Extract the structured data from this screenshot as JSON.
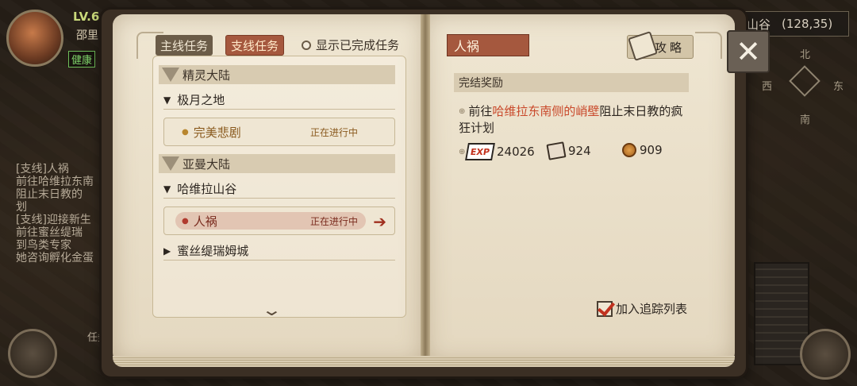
{
  "hud": {
    "level": "LV.6",
    "name": "邵里",
    "status": "健康",
    "location_name": "山谷",
    "coords": "(128,35)",
    "compass": {
      "n": "北",
      "w": "西",
      "e": "东",
      "s": "南"
    },
    "log": [
      {
        "prefix": "[支线]",
        "text": "人祸"
      },
      {
        "text": "前往哈维拉东南"
      },
      {
        "text": "阻止末日教的"
      },
      {
        "text": "划"
      },
      {
        "prefix": "[支线]",
        "text": "迎接新生"
      },
      {
        "text": "前往蜜丝缇瑞"
      },
      {
        "text": "到鸟类专家"
      },
      {
        "text": "她咨询孵化金蛋"
      }
    ],
    "left_button_label": "任务"
  },
  "left_page": {
    "tabs": {
      "main": "主线任务",
      "side": "支线任务"
    },
    "show_completed_label": "显示已完成任务",
    "regions": [
      {
        "name": "精灵大陆",
        "areas": [
          {
            "name": "极月之地",
            "expanded": true,
            "quests": [
              {
                "name": "完美悲剧",
                "status": "正在进行中",
                "selected": false
              }
            ]
          }
        ]
      },
      {
        "name": "亚曼大陆",
        "areas": [
          {
            "name": "哈维拉山谷",
            "expanded": true,
            "quests": [
              {
                "name": "人祸",
                "status": "正在进行中",
                "selected": true
              }
            ]
          },
          {
            "name": "蜜丝缇瑞姆城",
            "expanded": false,
            "quests": []
          }
        ]
      }
    ]
  },
  "right_page": {
    "quest_title": "人祸",
    "guide_label": "攻略",
    "reward_header": "完结奖励",
    "description": {
      "prefix": "前往",
      "place": "哈维拉东南侧的峭壁",
      "suffix": "阻止末日教的疯狂计划"
    },
    "rewards": {
      "exp_label": "EXP",
      "exp": "24026",
      "item": "924",
      "coin": "909"
    },
    "track_label": "加入追踪列表",
    "tracked": true
  },
  "icons": {
    "close": "close-icon",
    "guide": "scroll-icon",
    "scroll_down": "chevron-down-icon",
    "go": "arrow-right-icon"
  },
  "colors": {
    "accent": "#a5583e",
    "highlight_text": "#c9482a",
    "quest_status": "#8a5a1e"
  }
}
